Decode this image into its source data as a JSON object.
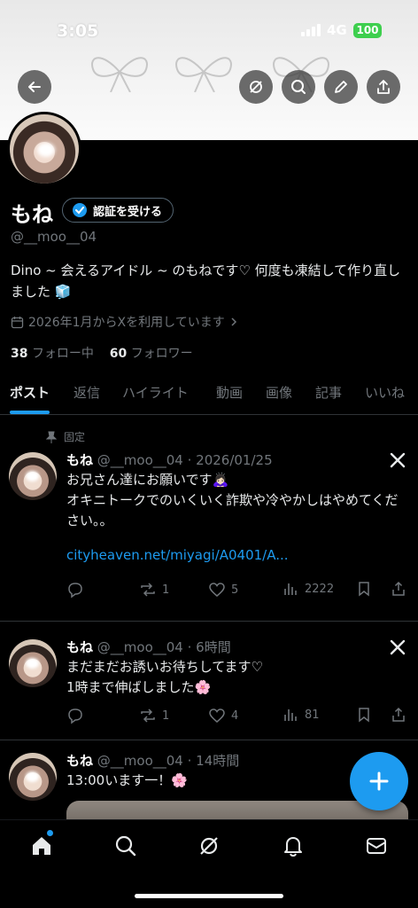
{
  "status_bar": {
    "time": "3:05",
    "network": "4G",
    "battery": "100"
  },
  "profile": {
    "name": "もね",
    "verify_label": "認証を受ける",
    "handle": "@__moo__04",
    "bio": "Dino ~ 会えるアイドル ~ のもねです♡ 何度も凍結して作り直しました 🧊",
    "joined": "2026年1月からXを利用しています",
    "following_count": "38",
    "following_label": "フォロー中",
    "followers_count": "60",
    "followers_label": "フォロワー"
  },
  "tabs": [
    "ポスト",
    "返信",
    "ハイライト",
    "動画",
    "画像",
    "記事",
    "いいね"
  ],
  "posts": [
    {
      "pinned_label": "固定",
      "name": "もね",
      "meta": "@__moo__04 · 2026/01/25",
      "line1": "お兄さん達にお願いです🙇🏻‍♀️",
      "line2": "オキニトークでのいくいく詐欺や冷やかしはやめてください。。",
      "link": "cityheaven.net/miyagi/A0401/A...",
      "replies": "",
      "reposts": "1",
      "likes": "5",
      "views": "2222"
    },
    {
      "name": "もね",
      "meta": "@__moo__04 · 6時間",
      "line1": "まだまだお誘いお待ちしてます♡",
      "line2": "1時まで伸ばしました🌸",
      "replies": "",
      "reposts": "1",
      "likes": "4",
      "views": "81"
    },
    {
      "name": "もね",
      "meta": "@__moo__04 · 14時間",
      "line1": "13:00います一！🌸"
    }
  ],
  "colors": {
    "accent": "#1d9bf0",
    "background": "#000000",
    "muted": "#71767b"
  }
}
